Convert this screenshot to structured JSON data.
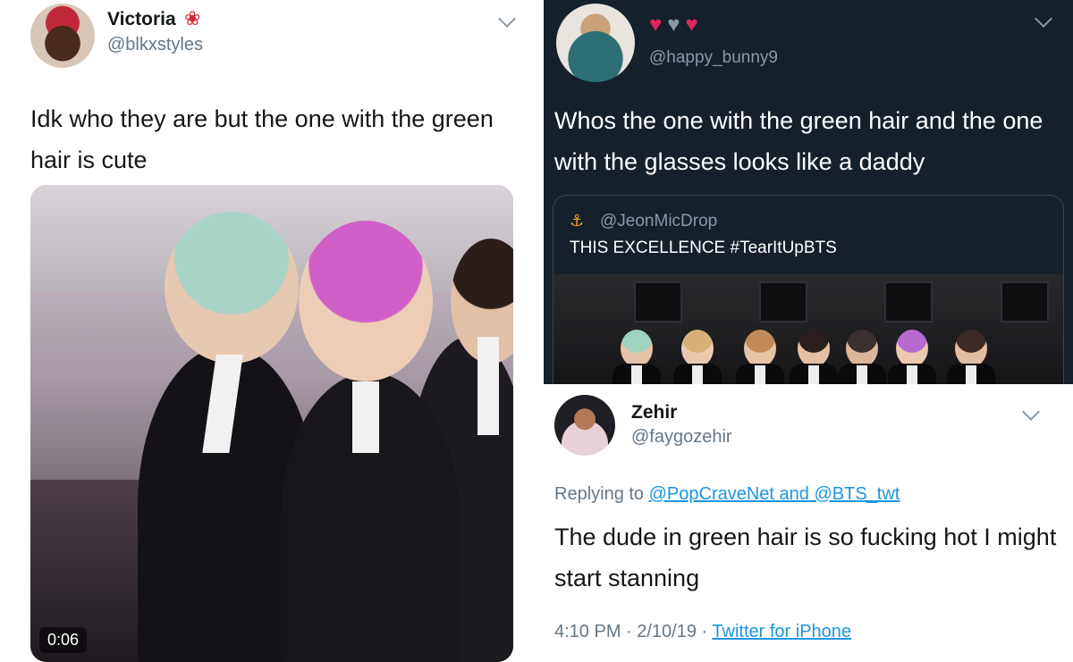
{
  "left_tweet": {
    "name": "Victoria",
    "name_emoji_icon": "hibiscus-icon",
    "handle": "@blkxstyles",
    "text": "Idk who they are but the one with the green hair is cute",
    "video_time": "0:06"
  },
  "dark_tweet": {
    "hearts": [
      "heart-red",
      "heart-grey",
      "heart-red"
    ],
    "handle": "@happy_bunny9",
    "text": "Whos the one with the green hair and the one with the glasses looks like a daddy",
    "quote": {
      "handle": "@JeonMicDrop",
      "text": "THIS EXCELLENCE #TearItUpBTS"
    }
  },
  "zehir_tweet": {
    "name": "Zehir",
    "handle": "@faygozehir",
    "reply_prefix": "Replying to",
    "reply_targets": "@PopCraveNet and @BTS_twt",
    "text": "The dude in green hair is so fucking hot I might start stanning",
    "timestamp": "4:10 PM · 2/10/19 ·",
    "source": "Twitter for iPhone"
  },
  "colors": {
    "dark_bg": "#15202b",
    "link_blue": "#1b95e0",
    "heart_red": "#e0245e"
  }
}
